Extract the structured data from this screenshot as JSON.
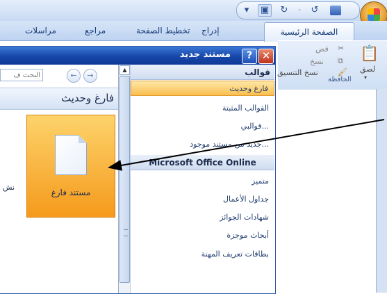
{
  "ribbon": {
    "tabs": {
      "home": "الصفحة الرئيسية",
      "insert": "إدراج",
      "page_layout": "تخطيط الصفحة",
      "references": "مراجع",
      "mailings": "مراسلات"
    },
    "clipboard": {
      "cut": "قص",
      "copy": "نسخ",
      "paste": "لصق",
      "format_painter": "نسخ التنسيق",
      "group_label": "الحافظة"
    }
  },
  "dialog": {
    "title": "مستند جديد",
    "close_icon": "close-icon",
    "help_icon": "help-icon",
    "templates_header": "قوالب",
    "templates": [
      {
        "label": "فارغ وحديث",
        "selected": true
      },
      {
        "label": "القوالب المثبتة",
        "selected": false
      },
      {
        "label": "قوالبي...",
        "selected": false
      },
      {
        "label": "جديد من مستند موجود...",
        "selected": false
      }
    ],
    "online_header": "Microsoft Office Online",
    "online_items": [
      {
        "label": "متميز"
      },
      {
        "label": "جداول الأعمال"
      },
      {
        "label": "شهادات الجوائز"
      },
      {
        "label": "أبحاث موجزة"
      },
      {
        "label": "بطاقات تعريف المهنة"
      }
    ],
    "search_placeholder": "البحث ف",
    "section_title": "فارغ وحديث",
    "blank_doc_label": "مستند فارغ",
    "cut_text": "نش"
  },
  "colors": {
    "title_bar": "#1747a8",
    "selected_item": "#f9bf50",
    "tile": "#f59a1c",
    "arrow": "#000000"
  }
}
